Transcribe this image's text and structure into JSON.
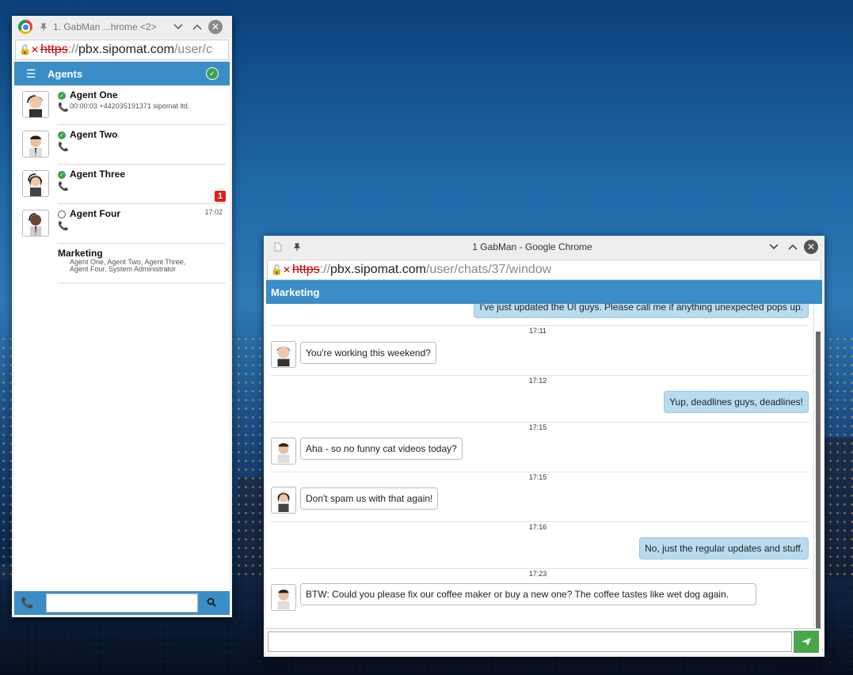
{
  "agents_window": {
    "title": "1. GabMan ...hrome <2>",
    "url": {
      "scheme": "https",
      "sep": "://",
      "host": "pbx.sipomat.com",
      "path": "/user/c"
    },
    "header_title": "Agents",
    "agents": [
      {
        "name": "Agent One",
        "sub": "00:00:03 +442035191371 sipomat ltd.",
        "status": "online",
        "time": "",
        "badge": ""
      },
      {
        "name": "Agent Two",
        "sub": "",
        "status": "online",
        "time": "",
        "badge": ""
      },
      {
        "name": "Agent Three",
        "sub": "",
        "status": "online",
        "time": "",
        "badge": "1"
      },
      {
        "name": "Agent Four",
        "sub": "",
        "status": "offline",
        "time": "17:02",
        "badge": ""
      }
    ],
    "group": {
      "name": "Marketing",
      "members_line1": "Agent One, Agent Two, Agent Three,",
      "members_line2": "Agent Four, System Administrator"
    }
  },
  "chat_window": {
    "title": "1 GabMan - Google Chrome",
    "url": {
      "scheme": "https",
      "sep": "://",
      "host": "pbx.sipomat.com",
      "path": "/user/chats/37/window"
    },
    "header_title": "Marketing",
    "messages": [
      {
        "dir": "out",
        "time": "",
        "text": "I've just updated the UI guys. Please call me if anything unexpected pops up."
      },
      {
        "dir": "in",
        "time": "17:11",
        "text": "You're working this weekend?"
      },
      {
        "dir": "out",
        "time": "17:12",
        "text": "Yup, deadlines guys, deadlines!"
      },
      {
        "dir": "in",
        "time": "17:15",
        "text": "Aha - so no funny cat videos today?"
      },
      {
        "dir": "in",
        "time": "17:15",
        "text": "Don't spam us with that again!"
      },
      {
        "dir": "out",
        "time": "17:16",
        "text": "No, just the regular updates and stuff."
      },
      {
        "dir": "in",
        "time": "17:23",
        "text": "BTW: Could you please fix our coffee maker or buy a new one? The coffee tastes like wet dog again."
      }
    ]
  },
  "colors": {
    "accent": "#3a8dc6",
    "online": "#3aa34a",
    "badge": "#e41b1b",
    "outgoing_bubble": "#b9dbef",
    "send": "#4aa64a"
  },
  "icons": [
    "chrome-icon",
    "pin-icon",
    "minimize-icon",
    "maximize-icon",
    "close-icon",
    "insecure-icon",
    "menu-icon",
    "check-icon",
    "phone-icon",
    "search-icon",
    "send-icon",
    "power-icon"
  ]
}
